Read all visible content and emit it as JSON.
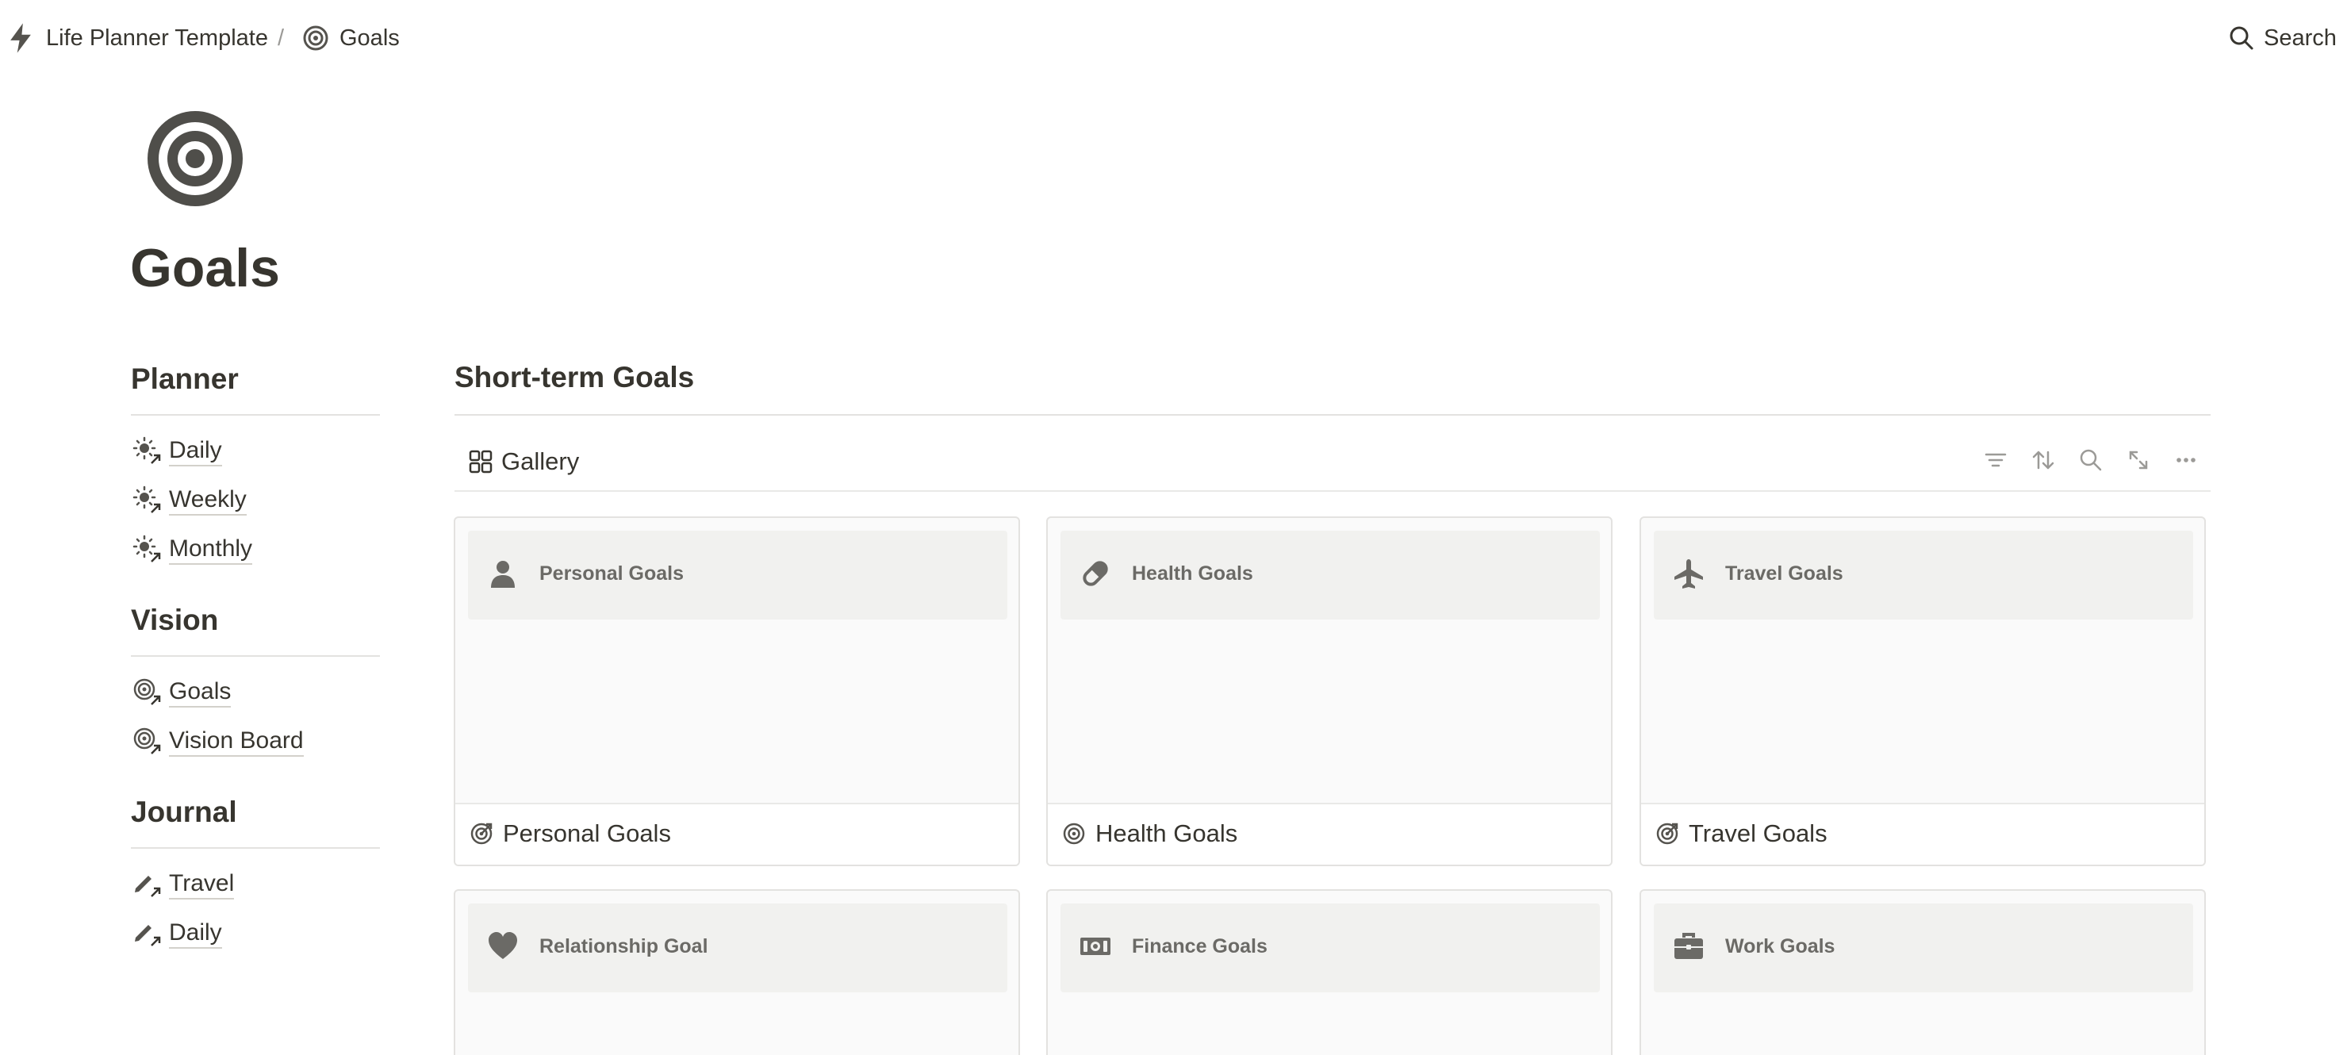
{
  "breadcrumb": {
    "workspace": "Life Planner Template",
    "separator": "/",
    "current": "Goals"
  },
  "search": {
    "label": "Search"
  },
  "page": {
    "title": "Goals"
  },
  "nav": {
    "sections": [
      {
        "heading": "Planner",
        "items": [
          "Daily",
          "Weekly",
          "Monthly"
        ]
      },
      {
        "heading": "Vision",
        "items": [
          "Goals",
          "Vision Board"
        ]
      },
      {
        "heading": "Journal",
        "items": [
          "Travel",
          "Daily"
        ]
      }
    ]
  },
  "main": {
    "section_title": "Short-term Goals",
    "view_label": "Gallery",
    "toolbar_icons": [
      "filter-icon",
      "sort-icon",
      "search-icon",
      "expand-icon",
      "more-icon"
    ],
    "cards": [
      {
        "cover_icon": "person-icon",
        "cover_label": "Personal Goals",
        "title": "Personal Goals"
      },
      {
        "cover_icon": "bandage-icon",
        "cover_label": "Health Goals",
        "title": "Health Goals"
      },
      {
        "cover_icon": "airplane-icon",
        "cover_label": "Travel Goals",
        "title": "Travel Goals"
      },
      {
        "cover_icon": "heart-icon",
        "cover_label": "Relationship Goal",
        "title": ""
      },
      {
        "cover_icon": "money-icon",
        "cover_label": "Finance Goals",
        "title": ""
      },
      {
        "cover_icon": "briefcase-icon",
        "cover_label": "Work Goals",
        "title": ""
      }
    ]
  },
  "colors": {
    "text": "#37352f",
    "muted_icon": "#6b6a66",
    "border": "#e3e2e0",
    "cover_bg": "#f1f1ef"
  }
}
